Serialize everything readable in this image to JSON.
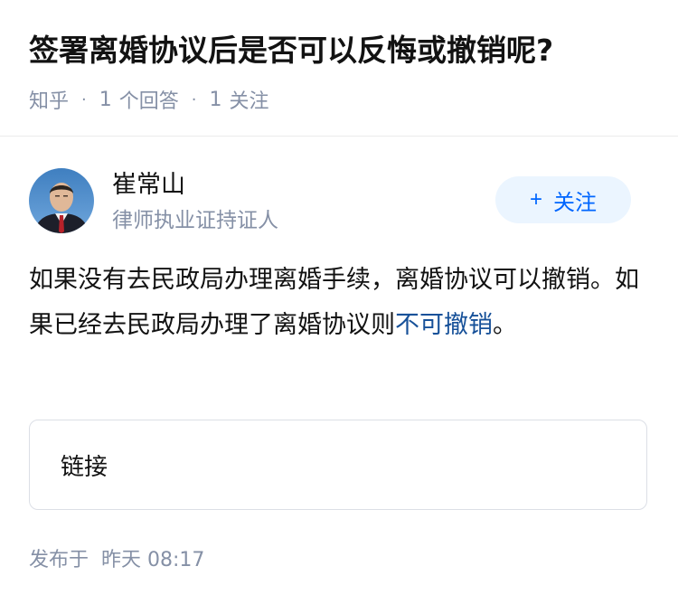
{
  "question": {
    "title": "签署离婚协议后是否可以反悔或撤销呢?",
    "source": "知乎",
    "answer_count": "1",
    "answer_label": "个回答",
    "follower_count": "1",
    "follower_label": "关注"
  },
  "author": {
    "name": "崔常山",
    "description": "律师执业证持证人"
  },
  "follow_button": {
    "plus": "+",
    "label": "关注"
  },
  "answer": {
    "text_part1": "如果没有去民政局办理离婚手续，离婚协议可以撤销。如果已经去民政局办理了离婚协议则",
    "link_text": "不可撤销",
    "text_part2": "。"
  },
  "link_card": {
    "label": "链接"
  },
  "footer": {
    "published_prefix": "发布于",
    "published_time": "昨天 08:17"
  },
  "colors": {
    "link": "#175199",
    "follow_text": "#0066ff",
    "follow_bg": "#ebf5ff",
    "meta": "#8590a6"
  }
}
